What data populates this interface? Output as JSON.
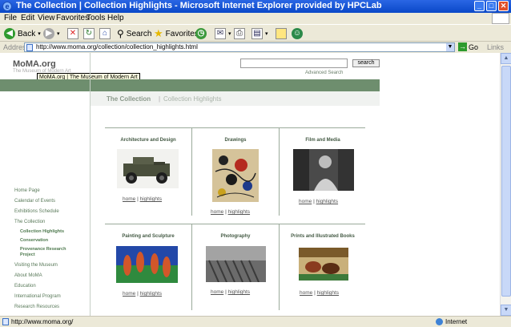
{
  "window": {
    "title": "The Collection | Collection Highlights - Microsoft Internet Explorer provided by HPCLab",
    "icon": "ie-icon",
    "controls": [
      "minimize",
      "maximize",
      "close"
    ]
  },
  "menu": [
    "File",
    "Edit",
    "View",
    "Favorites",
    "Tools",
    "Help"
  ],
  "toolbar": {
    "back_label": "Back",
    "search_label": "Search",
    "favorites_label": "Favorites"
  },
  "address": {
    "label": "Address",
    "url": "http://www.moma.org/collection/collection_highlights.html",
    "go_label": "Go",
    "links_label": "Links"
  },
  "page": {
    "logo": "MoMA.org",
    "logo_sub": "The Museum of Modern Art",
    "tooltip": "MoMA.org | The Museum of Modern Art",
    "search_button": "search",
    "advanced_search": "Advanced Search",
    "section_title": "The Collection",
    "section_sep": "|",
    "section_subtitle": "Collection Highlights",
    "nav": [
      {
        "label": "Home Page"
      },
      {
        "label": "Calendar of Events"
      },
      {
        "label": "Exhibitions Schedule"
      },
      {
        "label": "The Collection"
      },
      {
        "label": "Collection Highlights",
        "sub": true
      },
      {
        "label": "Conservation",
        "sub": true
      },
      {
        "label": "Provenance Research Project",
        "sub": true
      },
      {
        "label": "Visiting the Museum"
      },
      {
        "label": "About MoMA"
      },
      {
        "label": "Education"
      },
      {
        "label": "International Program"
      },
      {
        "label": "Research Resources"
      }
    ],
    "categories": [
      {
        "title": "Architecture and Design",
        "home": "home",
        "highlights": "highlights"
      },
      {
        "title": "Drawings",
        "home": "home",
        "highlights": "highlights"
      },
      {
        "title": "Film and Media",
        "home": "home",
        "highlights": "highlights"
      },
      {
        "title": "Painting and Sculpture",
        "home": "home",
        "highlights": "highlights"
      },
      {
        "title": "Photography",
        "home": "home",
        "highlights": "highlights"
      },
      {
        "title": "Prints and Illustrated Books",
        "home": "home",
        "highlights": "highlights"
      }
    ],
    "link_separator": "|"
  },
  "status": {
    "text": "http://www.moma.org/",
    "zone": "Internet"
  },
  "colors": {
    "titlebar": "#0a48c8",
    "band": "#6e8e6e",
    "chrome": "#ece9d8"
  }
}
